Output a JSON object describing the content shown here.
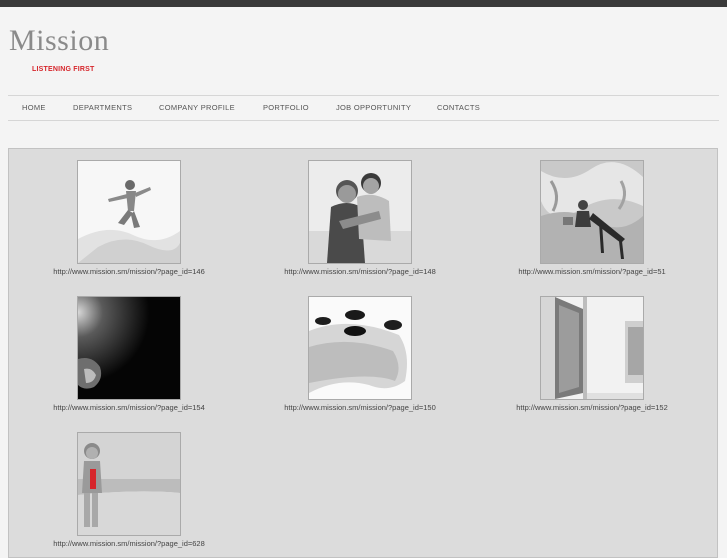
{
  "brand": {
    "logo": "Mission",
    "tagline": "LISTENING FIRST"
  },
  "nav": [
    {
      "label": "HOME"
    },
    {
      "label": "DEPARTMENTS"
    },
    {
      "label": "COMPANY PROFILE"
    },
    {
      "label": "PORTFOLIO"
    },
    {
      "label": "JOB OPPORTUNITY"
    },
    {
      "label": "CONTACTS"
    }
  ],
  "gallery": [
    {
      "caption": "http://www.mission.sm/mission/?page_id=146"
    },
    {
      "caption": "http://www.mission.sm/mission/?page_id=148"
    },
    {
      "caption": "http://www.mission.sm/mission/?page_id=51"
    },
    {
      "caption": "http://www.mission.sm/mission/?page_id=154"
    },
    {
      "caption": "http://www.mission.sm/mission/?page_id=150"
    },
    {
      "caption": "http://www.mission.sm/mission/?page_id=152"
    },
    {
      "caption": "http://www.mission.sm/mission/?page_id=628"
    }
  ]
}
